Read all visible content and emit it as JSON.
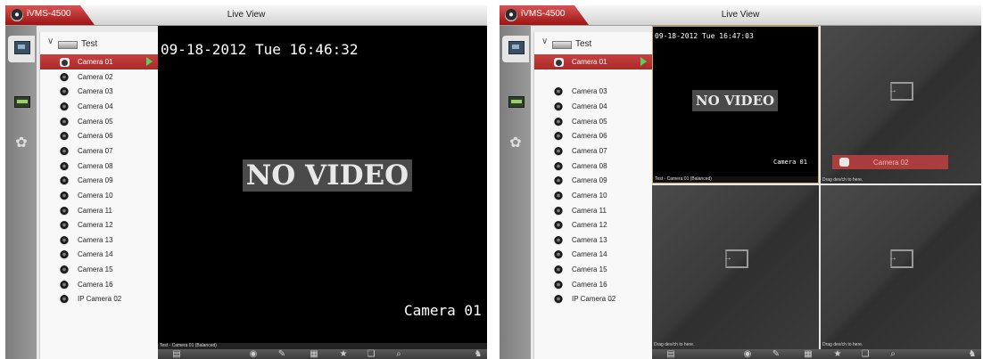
{
  "left": {
    "app_name": "iVMS-4500",
    "title": "Live View",
    "group": "Test",
    "cameras": [
      "Camera 01",
      "Camera 02",
      "Camera 03",
      "Camera 04",
      "Camera 05",
      "Camera 06",
      "Camera 07",
      "Camera 08",
      "Camera 09",
      "Camera 10",
      "Camera 11",
      "Camera 12",
      "Camera 13",
      "Camera 14",
      "Camera 15",
      "Camera 16",
      "IP Camera 02"
    ],
    "selected_camera": "Camera 01",
    "osd_time": "09-18-2012 Tue 16:46:32",
    "no_video": "NO VIDEO",
    "osd_camera": "Camera 01",
    "status": "Test - Camera 01 (Balanced)"
  },
  "right": {
    "app_name": "iVMS-4500",
    "title": "Live View",
    "group": "Test",
    "cameras": [
      "Camera 01",
      "",
      "Camera 03",
      "Camera 04",
      "Camera 05",
      "Camera 06",
      "Camera 07",
      "Camera 08",
      "Camera 09",
      "Camera 10",
      "Camera 11",
      "Camera 12",
      "Camera 13",
      "Camera 14",
      "Camera 15",
      "Camera 16",
      "IP Camera 02"
    ],
    "selected_camera": "Camera 01",
    "dragged_camera": "Camera 02",
    "osd_time": "09-18-2012 Tue 16:47:03",
    "no_video": "NO VIDEO",
    "osd_camera": "Camera 01",
    "status_active": "Test - Camera 01 (Balanced)",
    "drag_hint": "Drag dev/ch to here."
  },
  "toolbar_icons": [
    "layout-icon",
    "snapshot-icon",
    "record-icon",
    "ptz-icon",
    "favorite-icon",
    "copy-icon",
    "fullscreen-icon",
    "multi-screen-icon"
  ],
  "colors": {
    "accent_red": "#b83232",
    "play_green": "#5ad15a",
    "active_tile_border": "#c9a54a"
  }
}
